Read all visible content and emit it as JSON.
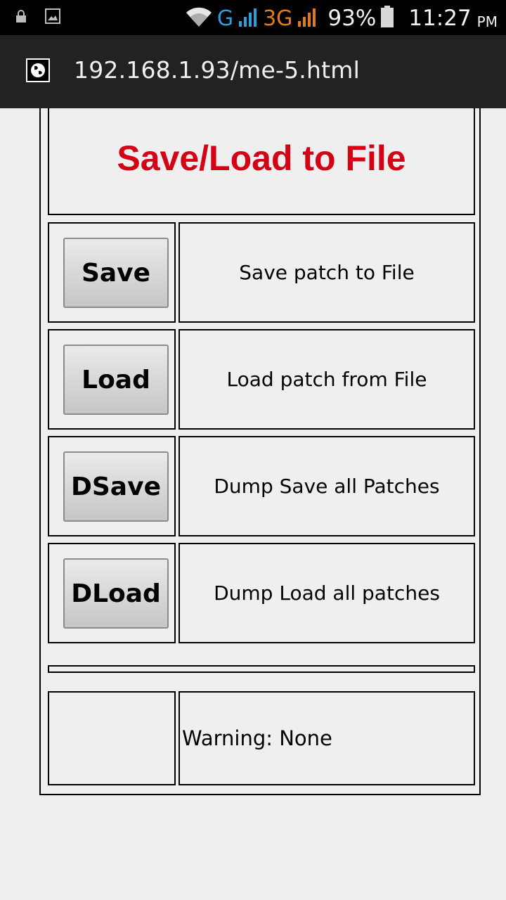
{
  "status_bar": {
    "battery_percent": "93%",
    "time": "11:27",
    "am_pm": "PM",
    "network_g": "G",
    "network_3g": "3G",
    "accent_g": "#2a9fd8",
    "accent_3g": "#e07b17"
  },
  "browser": {
    "url": "192.168.1.93/me-5.html"
  },
  "page": {
    "title": "Save/Load to File",
    "title_color": "#d40016",
    "rows": [
      {
        "button": "Save",
        "description": "Save patch to File"
      },
      {
        "button": "Load",
        "description": "Load patch from File"
      },
      {
        "button": "DSave",
        "description": "Dump Save all Patches"
      },
      {
        "button": "DLoad",
        "description": "Dump Load all patches"
      }
    ],
    "warning": "Warning: None"
  }
}
